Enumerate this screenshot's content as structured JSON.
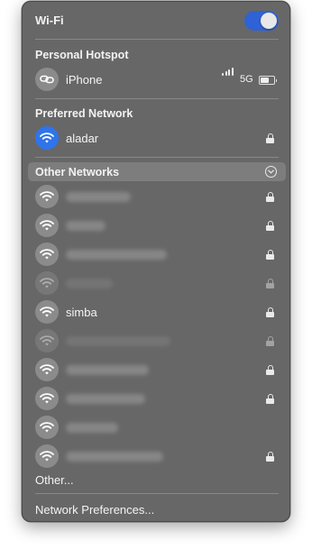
{
  "wifi": {
    "title": "Wi-Fi",
    "enabled": true
  },
  "hotspot": {
    "title": "Personal Hotspot",
    "device": "iPhone",
    "network_type": "5G",
    "signal_bars": 4
  },
  "preferred": {
    "title": "Preferred Network",
    "network": {
      "name": "aladar",
      "secured": true
    }
  },
  "other": {
    "title": "Other Networks",
    "networks": [
      {
        "name": "",
        "secured": true,
        "dimmed": false,
        "blurred": true
      },
      {
        "name": "",
        "secured": true,
        "dimmed": false,
        "blurred": true
      },
      {
        "name": "",
        "secured": true,
        "dimmed": false,
        "blurred": true
      },
      {
        "name": "",
        "secured": true,
        "dimmed": true,
        "blurred": true
      },
      {
        "name": "simba",
        "secured": true,
        "dimmed": false,
        "blurred": false
      },
      {
        "name": "",
        "secured": true,
        "dimmed": true,
        "blurred": true
      },
      {
        "name": "",
        "secured": true,
        "dimmed": false,
        "blurred": true
      },
      {
        "name": "",
        "secured": true,
        "dimmed": false,
        "blurred": true
      },
      {
        "name": "",
        "secured": false,
        "dimmed": false,
        "blurred": true
      },
      {
        "name": "",
        "secured": true,
        "dimmed": false,
        "blurred": true
      }
    ],
    "other_label": "Other..."
  },
  "footer": {
    "preferences_label": "Network Preferences..."
  },
  "icons": {
    "wifi": "wifi-icon",
    "hotspot": "link-icon",
    "lock": "lock-icon",
    "expand": "chevron-down-icon",
    "signal": "cellular-signal-icon",
    "battery": "battery-icon"
  },
  "colors": {
    "menu_bg": "#676767",
    "accent_blue": "#2f74ea",
    "toggle_on": "#2f62d4"
  }
}
